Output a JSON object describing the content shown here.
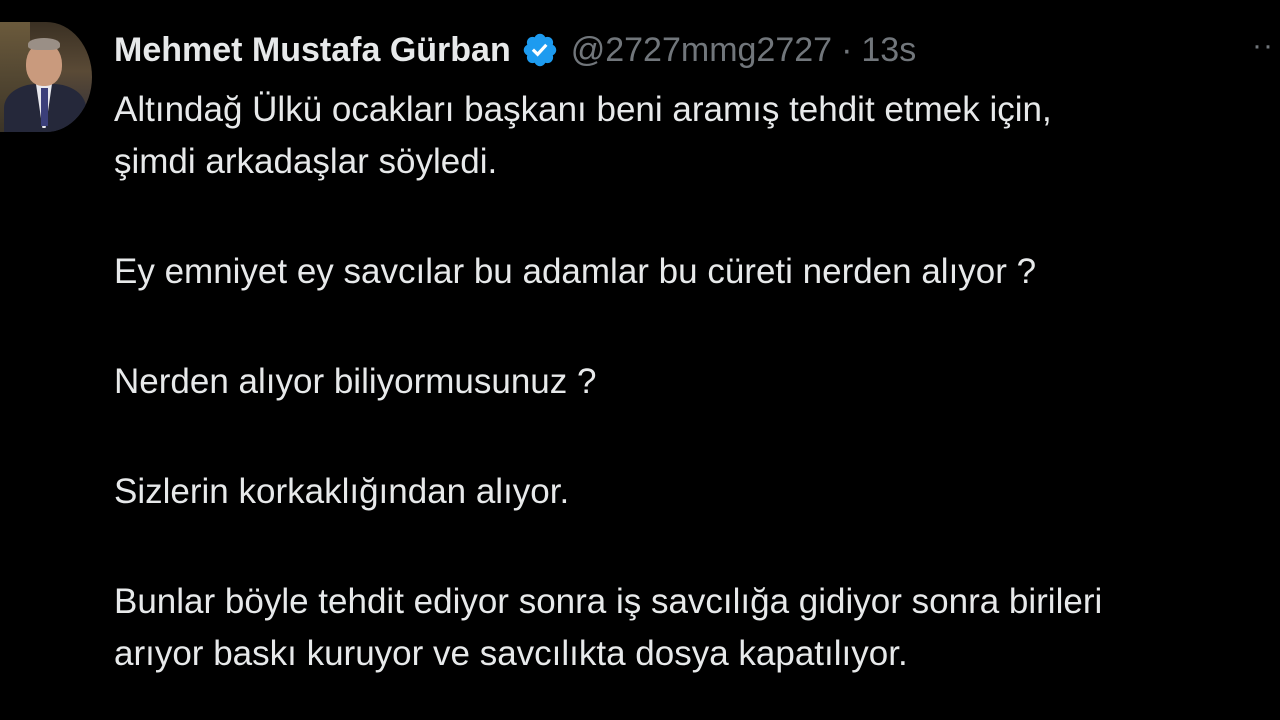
{
  "tweet": {
    "author": {
      "name": "Mehmet Mustafa Gürban",
      "handle": "@2727mmg2727",
      "separator": "·",
      "time": "13s",
      "verified_icon": "verified-badge-icon",
      "badge_color": "#1d9bf0"
    },
    "more_label": "··",
    "paragraphs": [
      {
        "lines": [
          "Altındağ Ülkü ocakları başkanı beni aramış tehdit etmek için,",
          "şimdi arkadaşlar söyledi."
        ]
      },
      {
        "lines": [
          "Ey emniyet ey savcılar bu adamlar bu cüreti nerden alıyor ?"
        ]
      },
      {
        "lines": [
          "Nerden alıyor biliyormusunuz ?"
        ]
      },
      {
        "lines": [
          "Sizlerin korkaklığından alıyor."
        ]
      },
      {
        "lines": [
          "Bunlar böyle tehdit ediyor sonra iş savcılığa gidiyor sonra birileri",
          "arıyor baskı kuruyor ve savcılıkta dosya kapatılıyor."
        ]
      }
    ]
  }
}
